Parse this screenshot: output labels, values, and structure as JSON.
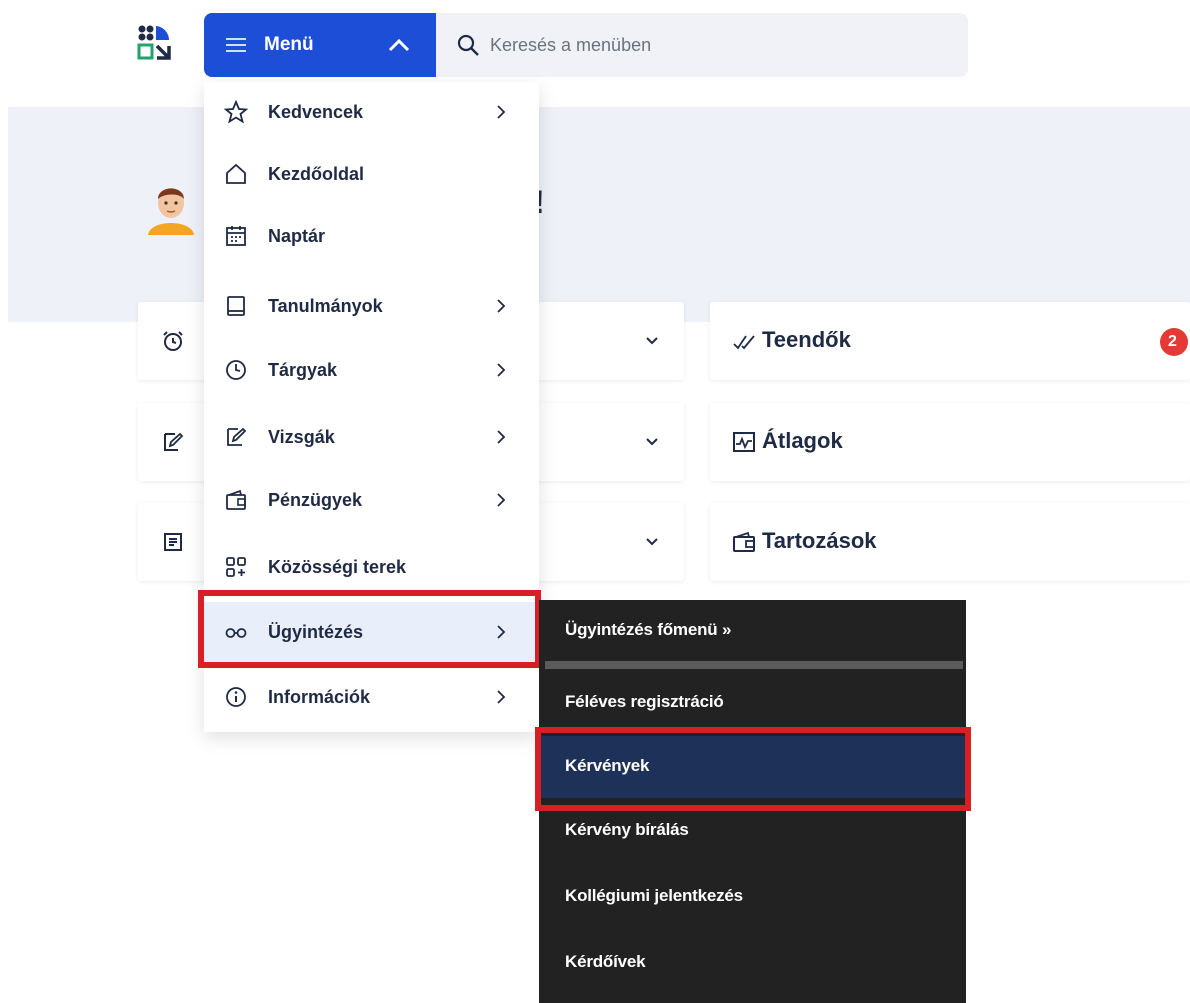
{
  "header": {
    "logo_icon": "app-logo-icon",
    "menu_label": "Menü",
    "search_placeholder": "Keresés a menüben"
  },
  "hero": {
    "greeting_tail": "!"
  },
  "cards_left": [
    {
      "icon": "alarm-clock-icon"
    },
    {
      "icon": "edit-note-icon"
    },
    {
      "icon": "document-list-icon"
    }
  ],
  "cards_right": [
    {
      "icon": "double-check-icon",
      "title": "Teendők",
      "badge": "2"
    },
    {
      "icon": "chart-icon",
      "title": "Átlagok"
    },
    {
      "icon": "wallet-icon",
      "title": "Tartozások"
    }
  ],
  "menu": {
    "items": [
      {
        "label": "Kedvencek",
        "icon": "star-icon",
        "has_submenu": true
      },
      {
        "label": "Kezdőoldal",
        "icon": "home-icon",
        "has_submenu": false
      },
      {
        "label": "Naptár",
        "icon": "calendar-icon",
        "has_submenu": false
      },
      {
        "label": "Tanulmányok",
        "icon": "book-icon",
        "has_submenu": true
      },
      {
        "label": "Tárgyak",
        "icon": "clock-icon",
        "has_submenu": true
      },
      {
        "label": "Vizsgák",
        "icon": "edit-note-icon",
        "has_submenu": true
      },
      {
        "label": "Pénzügyek",
        "icon": "wallet-icon",
        "has_submenu": true
      },
      {
        "label": "Közösségi terek",
        "icon": "grid-plus-icon",
        "has_submenu": false
      },
      {
        "label": "Ügyintézés",
        "icon": "glasses-icon",
        "has_submenu": true,
        "active": true
      },
      {
        "label": "Információk",
        "icon": "info-icon",
        "has_submenu": true
      }
    ]
  },
  "submenu": {
    "items": [
      {
        "label": "Ügyintézés főmenü »"
      },
      {
        "label": "Féléves regisztráció"
      },
      {
        "label": "Kérvények",
        "selected": true
      },
      {
        "label": "Kérvény bírálás"
      },
      {
        "label": "Kollégiumi jelentkezés"
      },
      {
        "label": "Kérdőívek"
      }
    ]
  },
  "colors": {
    "primary": "#1c4ed8",
    "highlight": "#d81f26",
    "submenu_bg": "#222222",
    "submenu_selected": "#1e3158",
    "badge": "#e53935"
  }
}
